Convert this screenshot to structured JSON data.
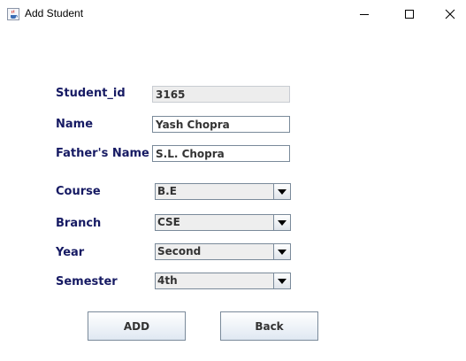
{
  "window": {
    "title": "Add Student",
    "icon": "java-cup-icon"
  },
  "form": {
    "student_id": {
      "label": "Student_id",
      "value": "3165"
    },
    "name": {
      "label": "Name",
      "value": "Yash Chopra"
    },
    "fathers_name": {
      "label": "Father's Name",
      "value": "S.L. Chopra"
    },
    "course": {
      "label": "Course",
      "value": "B.E"
    },
    "branch": {
      "label": "Branch",
      "value": "CSE"
    },
    "year": {
      "label": "Year",
      "value": "Second"
    },
    "semester": {
      "label": "Semester",
      "value": "4th"
    }
  },
  "buttons": {
    "add": "ADD",
    "back": "Back"
  },
  "colors": {
    "label": "#161a63",
    "field_text": "#333333"
  }
}
